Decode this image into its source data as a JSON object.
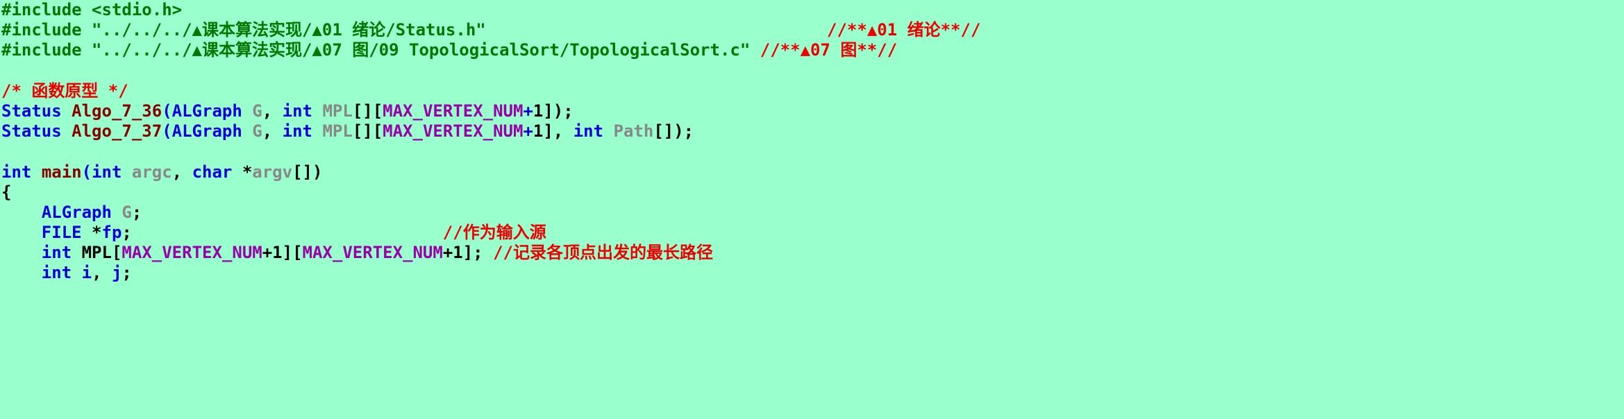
{
  "editor": {
    "background_color": "#99ffcc",
    "font_size_px": 24,
    "line_height_px": 29,
    "language": "C",
    "colors": {
      "preprocessor": "#007700",
      "comment": "#ee0000",
      "keyword": "#0000dd",
      "function": "#880000",
      "variable": "#888888",
      "macro": "#9900aa",
      "punctuation": "#000000"
    }
  },
  "lines": [
    {
      "index": 1,
      "text": "#include <stdio.h>",
      "tokens": [
        {
          "t": "#include <stdio.h>",
          "c": "t-pre"
        }
      ]
    },
    {
      "index": 2,
      "text": "#include \"../../../▲课本算法实现/▲01 绪论/Status.h\"                                  //**▲01 绪论**//",
      "tokens": [
        {
          "t": "#include \"../../../▲课本算法实现/▲01 绪论/Status.h\"",
          "c": "t-pre"
        },
        {
          "t": "                                  ",
          "c": "t-blank"
        },
        {
          "t": "//**▲01 绪论**//",
          "c": "t-comment"
        }
      ]
    },
    {
      "index": 3,
      "text": "#include \"../../../▲课本算法实现/▲07 图/09 TopologicalSort/TopologicalSort.c\" //**▲07 图**//",
      "tokens": [
        {
          "t": "#include \"../../../▲课本算法实现/▲07 图/09 TopologicalSort/TopologicalSort.c\"",
          "c": "t-pre"
        },
        {
          "t": " ",
          "c": "t-blank"
        },
        {
          "t": "//**▲07 图**//",
          "c": "t-comment"
        }
      ]
    },
    {
      "index": 4,
      "text": "",
      "tokens": []
    },
    {
      "index": 5,
      "text": "/* 函数原型 */",
      "tokens": [
        {
          "t": "/* 函数原型 */",
          "c": "t-comment"
        }
      ]
    },
    {
      "index": 6,
      "text": "Status Algo_7_36(ALGraph G, int MPL[][MAX_VERTEX_NUM+1]);",
      "tokens": [
        {
          "t": "Status",
          "c": "t-kw"
        },
        {
          "t": " ",
          "c": "t-blank"
        },
        {
          "t": "Algo_7_36",
          "c": "t-fn"
        },
        {
          "t": "(",
          "c": "t-kw"
        },
        {
          "t": "ALGraph",
          "c": "t-kw"
        },
        {
          "t": " ",
          "c": "t-blank"
        },
        {
          "t": "G",
          "c": "t-var"
        },
        {
          "t": ",",
          "c": "t-punct"
        },
        {
          "t": " ",
          "c": "t-blank"
        },
        {
          "t": "int",
          "c": "t-kw"
        },
        {
          "t": " ",
          "c": "t-blank"
        },
        {
          "t": "MPL",
          "c": "t-var"
        },
        {
          "t": "[][",
          "c": "t-punct"
        },
        {
          "t": "MAX_VERTEX_NUM",
          "c": "t-macro"
        },
        {
          "t": "+",
          "c": "t-kw"
        },
        {
          "t": "1",
          "c": "t-num"
        },
        {
          "t": "]);",
          "c": "t-punct"
        }
      ]
    },
    {
      "index": 7,
      "text": "Status Algo_7_37(ALGraph G, int MPL[][MAX_VERTEX_NUM+1], int Path[]);",
      "tokens": [
        {
          "t": "Status",
          "c": "t-kw"
        },
        {
          "t": " ",
          "c": "t-blank"
        },
        {
          "t": "Algo_7_37",
          "c": "t-fn"
        },
        {
          "t": "(",
          "c": "t-kw"
        },
        {
          "t": "ALGraph",
          "c": "t-kw"
        },
        {
          "t": " ",
          "c": "t-blank"
        },
        {
          "t": "G",
          "c": "t-var"
        },
        {
          "t": ",",
          "c": "t-punct"
        },
        {
          "t": " ",
          "c": "t-blank"
        },
        {
          "t": "int",
          "c": "t-kw"
        },
        {
          "t": " ",
          "c": "t-blank"
        },
        {
          "t": "MPL",
          "c": "t-var"
        },
        {
          "t": "[][",
          "c": "t-punct"
        },
        {
          "t": "MAX_VERTEX_NUM",
          "c": "t-macro"
        },
        {
          "t": "+",
          "c": "t-kw"
        },
        {
          "t": "1",
          "c": "t-num"
        },
        {
          "t": "],",
          "c": "t-punct"
        },
        {
          "t": " ",
          "c": "t-blank"
        },
        {
          "t": "int",
          "c": "t-kw"
        },
        {
          "t": " ",
          "c": "t-blank"
        },
        {
          "t": "Path",
          "c": "t-var"
        },
        {
          "t": "[]);",
          "c": "t-punct"
        }
      ]
    },
    {
      "index": 8,
      "text": "",
      "tokens": []
    },
    {
      "index": 9,
      "text": "int main(int argc, char *argv[])",
      "tokens": [
        {
          "t": "int",
          "c": "t-kw"
        },
        {
          "t": " ",
          "c": "t-blank"
        },
        {
          "t": "main",
          "c": "t-fn"
        },
        {
          "t": "(",
          "c": "t-kw"
        },
        {
          "t": "int",
          "c": "t-kw"
        },
        {
          "t": " ",
          "c": "t-blank"
        },
        {
          "t": "argc",
          "c": "t-var"
        },
        {
          "t": ",",
          "c": "t-punct"
        },
        {
          "t": " ",
          "c": "t-blank"
        },
        {
          "t": "char",
          "c": "t-kw"
        },
        {
          "t": " ",
          "c": "t-blank"
        },
        {
          "t": "*",
          "c": "t-punct"
        },
        {
          "t": "argv",
          "c": "t-var"
        },
        {
          "t": "[])",
          "c": "t-punct"
        }
      ]
    },
    {
      "index": 10,
      "text": "{",
      "tokens": [
        {
          "t": "{",
          "c": "t-punct"
        }
      ]
    },
    {
      "index": 11,
      "text": "    ALGraph G;",
      "tokens": [
        {
          "t": "    ",
          "c": "t-blank"
        },
        {
          "t": "ALGraph",
          "c": "t-kw"
        },
        {
          "t": " ",
          "c": "t-blank"
        },
        {
          "t": "G",
          "c": "t-var"
        },
        {
          "t": ";",
          "c": "t-punct"
        }
      ]
    },
    {
      "index": 12,
      "text": "    FILE *fp;                               //作为输入源",
      "tokens": [
        {
          "t": "    ",
          "c": "t-blank"
        },
        {
          "t": "FILE",
          "c": "t-kw"
        },
        {
          "t": " ",
          "c": "t-blank"
        },
        {
          "t": "*",
          "c": "t-punct"
        },
        {
          "t": "fp",
          "c": "t-kw"
        },
        {
          "t": ";",
          "c": "t-punct"
        },
        {
          "t": "                               ",
          "c": "t-blank"
        },
        {
          "t": "//作为输入源",
          "c": "t-comment"
        }
      ]
    },
    {
      "index": 13,
      "text": "    int MPL[MAX_VERTEX_NUM+1][MAX_VERTEX_NUM+1]; //记录各顶点出发的最长路径",
      "tokens": [
        {
          "t": "    ",
          "c": "t-blank"
        },
        {
          "t": "int",
          "c": "t-kw"
        },
        {
          "t": " ",
          "c": "t-blank"
        },
        {
          "t": "MPL",
          "c": "t-punct"
        },
        {
          "t": "[",
          "c": "t-punct"
        },
        {
          "t": "MAX_VERTEX_NUM",
          "c": "t-macro"
        },
        {
          "t": "+",
          "c": "t-punct"
        },
        {
          "t": "1",
          "c": "t-punct"
        },
        {
          "t": "][",
          "c": "t-punct"
        },
        {
          "t": "MAX_VERTEX_NUM",
          "c": "t-macro"
        },
        {
          "t": "+",
          "c": "t-punct"
        },
        {
          "t": "1",
          "c": "t-punct"
        },
        {
          "t": "]; ",
          "c": "t-punct"
        },
        {
          "t": "//记录各顶点出发的最长路径",
          "c": "t-comment"
        }
      ]
    },
    {
      "index": 14,
      "text": "    int i, j;",
      "tokens": [
        {
          "t": "    ",
          "c": "t-blank"
        },
        {
          "t": "int",
          "c": "t-kw"
        },
        {
          "t": " ",
          "c": "t-blank"
        },
        {
          "t": "i",
          "c": "t-kw"
        },
        {
          "t": ",",
          "c": "t-punct"
        },
        {
          "t": " ",
          "c": "t-blank"
        },
        {
          "t": "j",
          "c": "t-kw"
        },
        {
          "t": ";",
          "c": "t-punct"
        }
      ]
    }
  ]
}
